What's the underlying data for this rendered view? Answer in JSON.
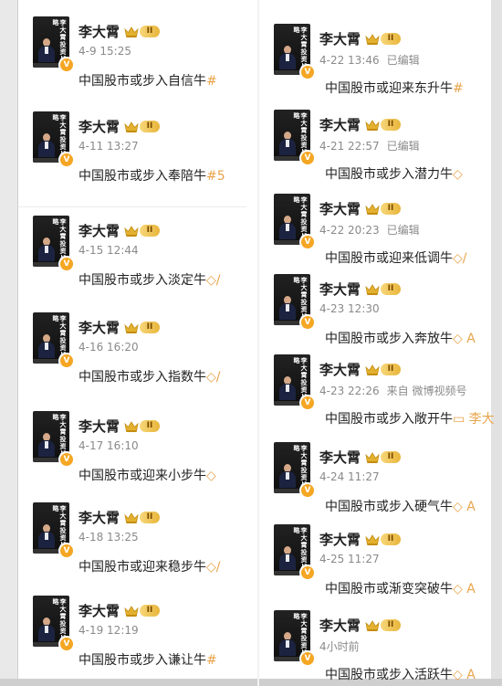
{
  "author": {
    "name": "李大霄",
    "level": "II",
    "verified_mark": "V"
  },
  "avatar_book_title": "李大霄投资战略",
  "posts_left": [
    {
      "time": "4-9 15:25",
      "source": "",
      "text": "中国股市或步入自信牛",
      "trail": "#"
    },
    {
      "time": "4-11 13:27",
      "source": "",
      "text": "中国股市或步入奉陪牛",
      "trail": "#5"
    },
    {
      "time": "4-15 12:44",
      "source": "",
      "text": "中国股市或步入淡定牛",
      "trail": "◇/"
    },
    {
      "time": "4-16 16:20",
      "source": "",
      "text": "中国股市或步入指数牛",
      "trail": "◇/"
    },
    {
      "time": "4-17 16:10",
      "source": "",
      "text": "中国股市或迎来小步牛",
      "trail": "◇"
    },
    {
      "time": "4-18 13:25",
      "source": "",
      "text": "中国股市或迎来稳步牛",
      "trail": "◇/"
    },
    {
      "time": "4-19 12:19",
      "source": "",
      "text": "中国股市或步入谦让牛",
      "trail": "#"
    }
  ],
  "posts_right": [
    {
      "time": "4-22 13:46",
      "source": "已编辑",
      "text": "中国股市或迎来东升牛",
      "trail": "#"
    },
    {
      "time": "4-21 22:57",
      "source": "已编辑",
      "text": "中国股市或步入潜力牛",
      "trail": "◇"
    },
    {
      "time": "4-22 20:23",
      "source": "已编辑",
      "text": "中国股市或迎来低调牛",
      "trail": "◇/"
    },
    {
      "time": "4-23 12:30",
      "source": "",
      "text": "中国股市或步入奔放牛",
      "trail": "◇ A"
    },
    {
      "time": "4-23 22:26",
      "source": "来自 微博视频号",
      "text": "中国股市或步入敞开牛",
      "trail": "▭ 李大"
    },
    {
      "time": "4-24 11:27",
      "source": "",
      "text": "中国股市或步入硬气牛",
      "trail": "◇ A"
    },
    {
      "time": "4-25 11:27",
      "source": "",
      "text": "中国股市或渐变突破牛",
      "trail": "◇ A"
    },
    {
      "time": "4小时前",
      "source": "",
      "text": "中国股市或步入活跃牛",
      "trail": "◇ A"
    }
  ],
  "colors": {
    "accent": "#f5a623",
    "meta": "#8a8a8a",
    "tag": "#e9a44b"
  }
}
